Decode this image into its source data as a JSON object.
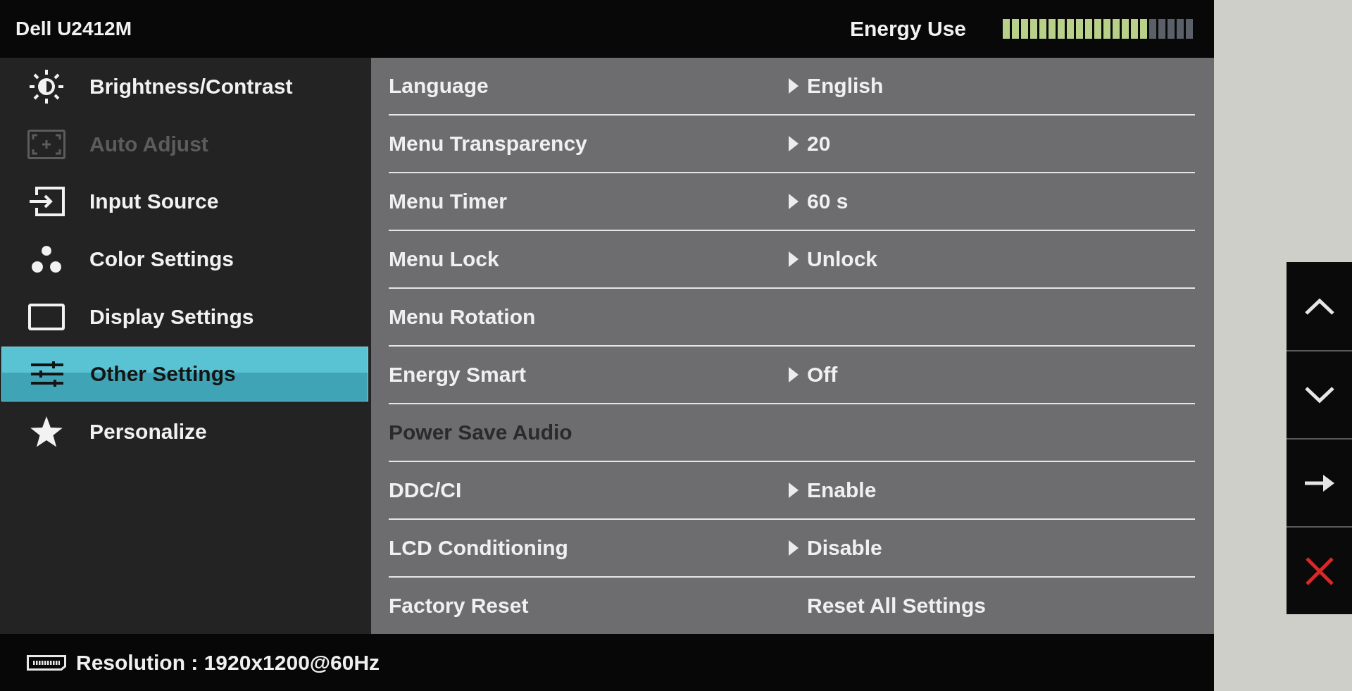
{
  "header": {
    "title": "Dell U2412M",
    "energy": {
      "label": "Energy Use",
      "level": 0.76
    }
  },
  "menu": [
    {
      "label": "Brightness/Contrast",
      "selected": false,
      "disabled": false
    },
    {
      "label": "Auto Adjust",
      "selected": false,
      "disabled": true
    },
    {
      "label": "Input Source",
      "selected": false,
      "disabled": false
    },
    {
      "label": "Color Settings",
      "selected": false,
      "disabled": false
    },
    {
      "label": "Display Settings",
      "selected": false,
      "disabled": false
    },
    {
      "label": "Other Settings",
      "selected": true,
      "disabled": false
    },
    {
      "label": "Personalize",
      "selected": false,
      "disabled": false
    }
  ],
  "options": [
    {
      "label": "Language",
      "disabled": false,
      "value": "English",
      "arrow": true
    },
    {
      "label": "Menu Transparency",
      "disabled": false,
      "value": "20",
      "arrow": true
    },
    {
      "label": "Menu Timer",
      "disabled": false,
      "value": "60 s",
      "arrow": true
    },
    {
      "label": "Menu Lock",
      "disabled": false,
      "value": "Unlock",
      "arrow": true
    },
    {
      "label": "Menu Rotation",
      "disabled": false
    },
    {
      "label": "Energy Smart",
      "disabled": false,
      "value": "Off",
      "arrow": true
    },
    {
      "label": "Power Save Audio",
      "disabled": true
    },
    {
      "label": "DDC/CI",
      "disabled": false,
      "value": "Enable",
      "arrow": true
    },
    {
      "label": "LCD Conditioning",
      "disabled": false,
      "value": "Disable",
      "arrow": true
    },
    {
      "label": "Factory Reset",
      "disabled": false,
      "value": "Reset All Settings",
      "arrow": false
    }
  ],
  "status_bar": {
    "text": "Resolution : 1920x1200@60Hz"
  }
}
